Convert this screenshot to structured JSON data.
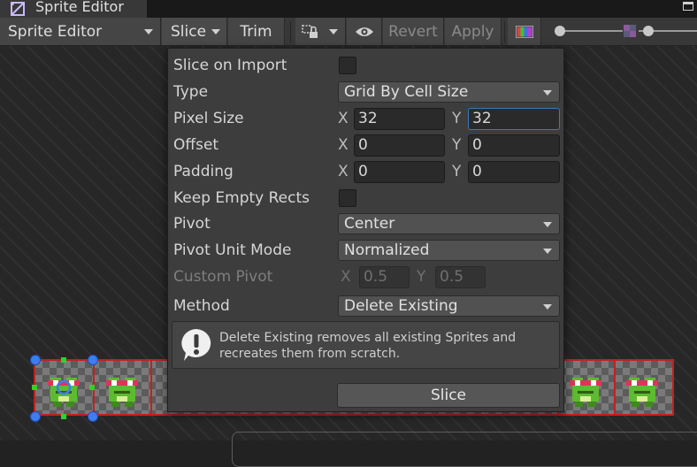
{
  "window": {
    "tab_title": "Sprite Editor"
  },
  "toolbar": {
    "mode_dropdown": "Sprite Editor",
    "slice_label": "Slice",
    "trim_label": "Trim",
    "revert_label": "Revert",
    "apply_label": "Apply"
  },
  "slice_panel": {
    "slice_on_import": {
      "label": "Slice on Import",
      "checked": false
    },
    "type": {
      "label": "Type",
      "value": "Grid By Cell Size"
    },
    "pixel_size": {
      "label": "Pixel Size",
      "x_label": "X",
      "x": "32",
      "y_label": "Y",
      "y": "32"
    },
    "offset": {
      "label": "Offset",
      "x_label": "X",
      "x": "0",
      "y_label": "Y",
      "y": "0"
    },
    "padding": {
      "label": "Padding",
      "x_label": "X",
      "x": "0",
      "y_label": "Y",
      "y": "0"
    },
    "keep_empty_rects": {
      "label": "Keep Empty Rects",
      "checked": false
    },
    "pivot": {
      "label": "Pivot",
      "value": "Center"
    },
    "pivot_unit_mode": {
      "label": "Pivot Unit Mode",
      "value": "Normalized"
    },
    "custom_pivot": {
      "label": "Custom Pivot",
      "x_label": "X",
      "x": "0.5",
      "y_label": "Y",
      "y": "0.5"
    },
    "method": {
      "label": "Method",
      "value": "Delete Existing"
    },
    "help_text": "Delete Existing removes all existing Sprites and recreates them from scratch.",
    "slice_button": "Slice"
  },
  "colors": {
    "slice_outline": "#c32020",
    "selection_handle": "#3d7df0",
    "focus_border": "#3a79bb"
  }
}
